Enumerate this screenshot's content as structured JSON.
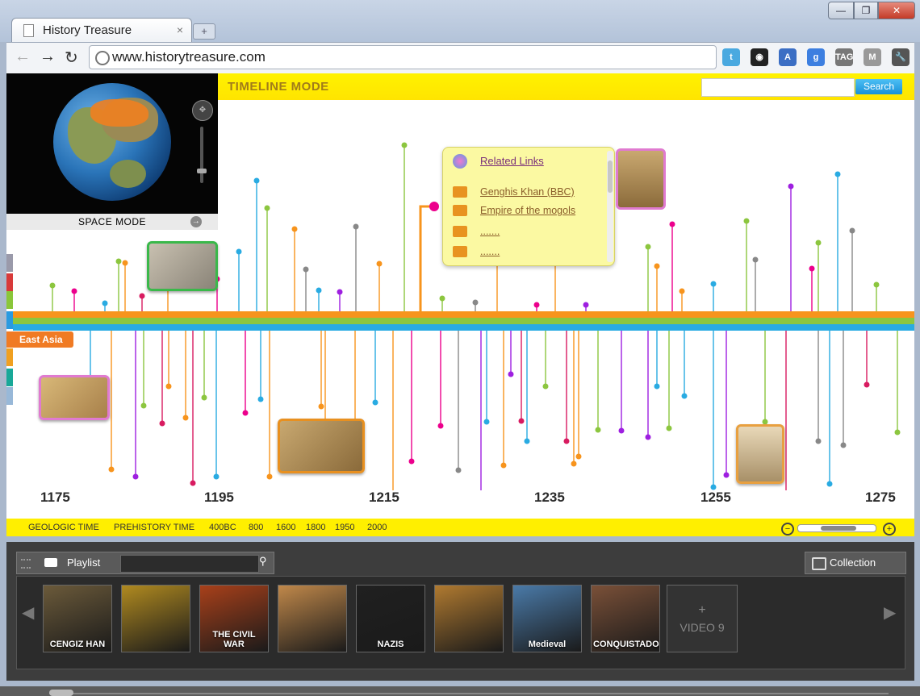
{
  "browser": {
    "tab_title": "History Treasure",
    "tab_close": "×",
    "new_tab": "+",
    "url": "www.historytreasure.com",
    "min_label": "—",
    "max_label": "❐",
    "close_label": "✕",
    "back": "←",
    "forward": "→",
    "reload": "↻",
    "extensions": [
      "twitter-icon",
      "color-picker-icon",
      "translate-icon",
      "google-icon",
      "tag-icon",
      "gmail-icon",
      "wrench-icon"
    ],
    "ext_glyphs": [
      "t",
      "◉",
      "A",
      "g",
      "TAG",
      "M",
      "🔧"
    ],
    "ext_colors": [
      "#4aa9e0",
      "#222222",
      "#3b6ec4",
      "#3d7fe0",
      "#777777",
      "#999999",
      "#555555"
    ]
  },
  "map": {
    "mode_label": "SPACE   MODE",
    "arrow": "→"
  },
  "timeline": {
    "mode_label": "TIMELINE  MODE",
    "search_placeholder": "",
    "search_button": "Search",
    "region_label": "East Asia",
    "years": [
      "1175",
      "1195",
      "1215",
      "1235",
      "1255",
      "1275"
    ],
    "eras": [
      "GEOLOGIC TIME",
      "PREHISTORY TIME",
      "400BC",
      "800",
      "1600",
      "1800",
      "1950",
      "2000"
    ],
    "zoom_out": "−",
    "zoom_in": "+",
    "category_colors": [
      "#9a9aaa",
      "#d83a3a",
      "#8ac63a",
      "#2a9ae0",
      "#f0a020",
      "#18a898",
      "#98b8d8"
    ]
  },
  "popup": {
    "related_links": "Related Links",
    "links": [
      "Genghis Khan (BBC)",
      "Empire of the mogols",
      ".......",
      "......."
    ]
  },
  "dock": {
    "playlist_label": "Playlist",
    "playlist_search": "",
    "search_icon": "⚲",
    "collection_label": "Collection",
    "videos": [
      {
        "label": "CENGIZ HAN",
        "color": "#6b5a3a"
      },
      {
        "label": "",
        "color": "#b08a20"
      },
      {
        "label": "THE CIVIL WAR",
        "color": "#a8401a"
      },
      {
        "label": "",
        "color": "#c0884a"
      },
      {
        "label": "NAZIS",
        "color": "#202020"
      },
      {
        "label": "",
        "color": "#b07a30"
      },
      {
        "label": "Medieval",
        "color": "#4a7aa8"
      },
      {
        "label": "CONQUISTADORS",
        "color": "#7a5038"
      }
    ],
    "add_video_plus": "+",
    "add_video_label": "VIDEO 9",
    "prev": "◀",
    "next": "▶"
  }
}
